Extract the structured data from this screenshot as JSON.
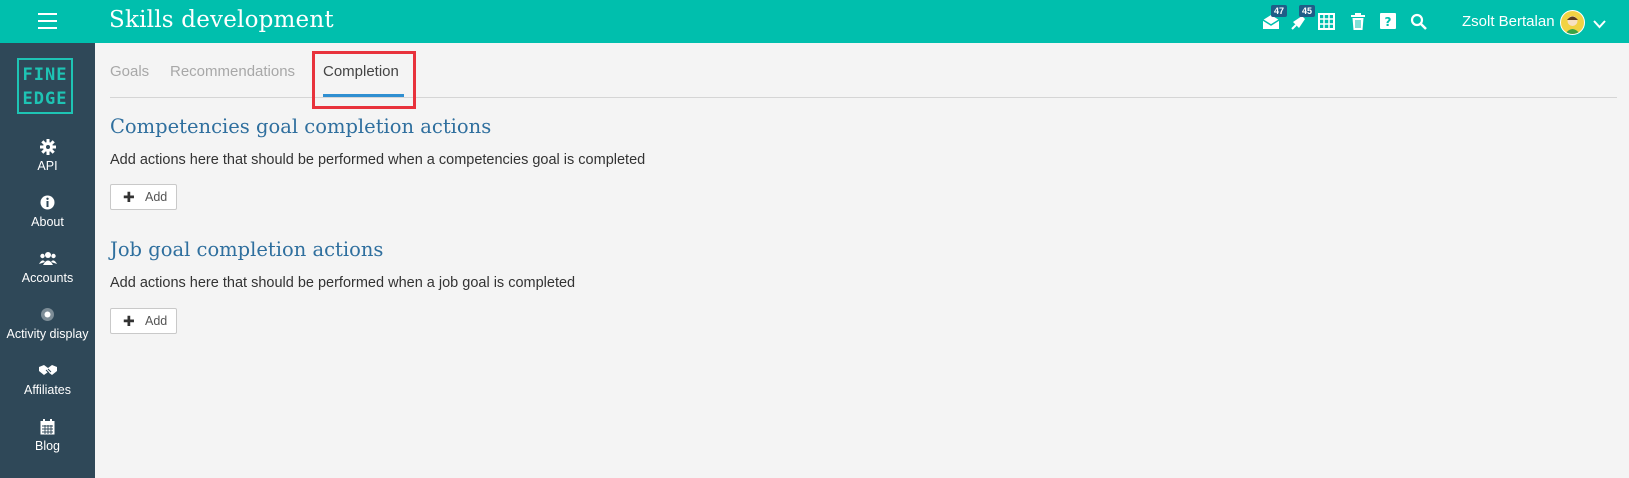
{
  "header": {
    "title": "Skills development",
    "messages_badge": "47",
    "notifications_badge": "45",
    "user_name": "Zsolt Bertalan"
  },
  "logo": {
    "line1": "FINE",
    "line2": "EDGE"
  },
  "sidebar": {
    "items": [
      {
        "label": "API",
        "icon": "gear-icon"
      },
      {
        "label": "About",
        "icon": "info-icon"
      },
      {
        "label": "Accounts",
        "icon": "users-icon"
      },
      {
        "label": "Activity display",
        "icon": "dot-circle-icon"
      },
      {
        "label": "Affiliates",
        "icon": "handshake-icon"
      },
      {
        "label": "Blog",
        "icon": "calendar-icon"
      }
    ]
  },
  "tabs": [
    {
      "label": "Goals",
      "active": false
    },
    {
      "label": "Recommendations",
      "active": false
    },
    {
      "label": "Completion",
      "active": true
    }
  ],
  "sections": [
    {
      "title": "Competencies goal completion actions",
      "description": "Add actions here that should be performed when a competencies goal is completed",
      "button_label": "Add"
    },
    {
      "title": "Job goal completion actions",
      "description": "Add actions here that should be performed when a job goal is completed",
      "button_label": "Add"
    }
  ],
  "colors": {
    "topbar": "#00bfad",
    "sidebar": "#2f4858",
    "accent": "#2f8fd1",
    "section_title": "#2f6f9e",
    "highlight": "#e8323c"
  }
}
